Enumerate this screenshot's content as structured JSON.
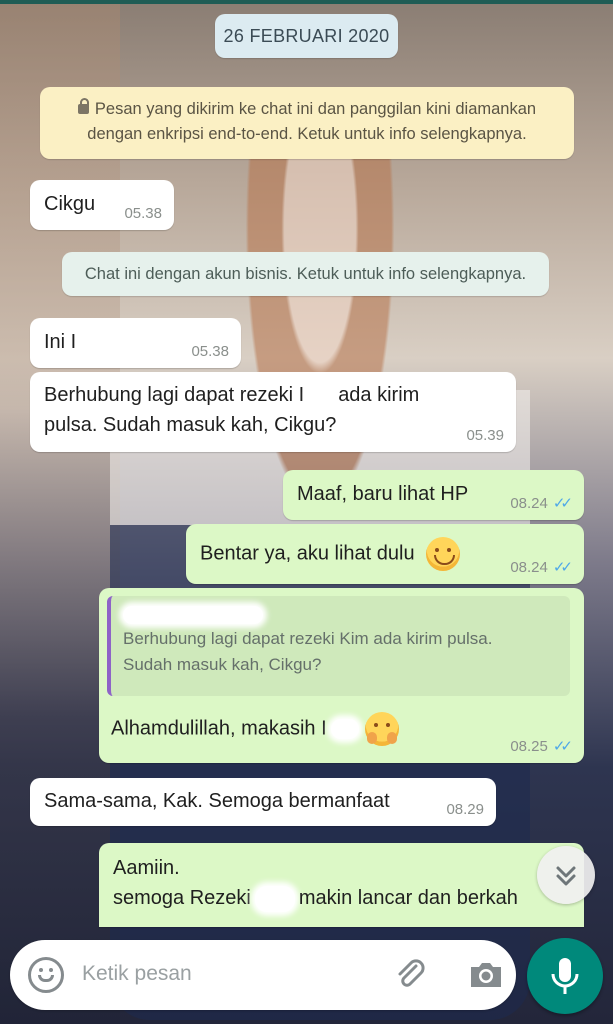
{
  "date_chip": "26 FEBRUARI 2020",
  "encryption_notice": {
    "line1": "Pesan yang dikirim ke chat ini dan panggilan kini diamankan",
    "line2": "dengan enkripsi end-to-end. Ketuk untuk info selengkapnya."
  },
  "business_notice": "Chat ini dengan akun bisnis. Ketuk untuk info selengkapnya.",
  "messages": [
    {
      "text": "Cikgu",
      "time": "05.38"
    },
    {
      "text": "Ini I",
      "time": "05.38"
    },
    {
      "line1a": "Berhubung lagi dapat rezeki I",
      "line1b": "ada kirim",
      "line2": "pulsa. Sudah masuk kah, Cikgu?",
      "time": "05.39"
    },
    {
      "text": "Maaf, baru lihat HP",
      "time": "08.24"
    },
    {
      "text": "Bentar ya, aku lihat dulu",
      "time": "08.24"
    },
    {
      "quote_line1": "Berhubung lagi dapat rezeki Kim ada kirim pulsa.",
      "quote_line2": "Sudah masuk kah, Cikgu?",
      "text": "Alhamdulillah, makasih I",
      "time": "08.25"
    },
    {
      "text": "Sama-sama, Kak. Semoga bermanfaat",
      "time": "08.29"
    },
    {
      "line1": "Aamiin.",
      "line2a": "semoga Rezeki",
      "line2b": "makin lancar dan berkah"
    }
  ],
  "input": {
    "placeholder": "Ketik pesan"
  },
  "icons": [
    "emoji-icon",
    "attach-icon",
    "camera-icon",
    "mic-icon",
    "scroll-down-icon",
    "lock-icon",
    "double-check-icon"
  ],
  "colors": {
    "outgoing": "#dcf8c6",
    "incoming": "#ffffff",
    "accent": "#00897b",
    "ticks": "#4fa8e8"
  }
}
